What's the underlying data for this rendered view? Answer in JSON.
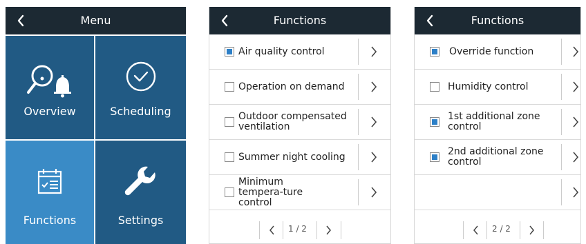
{
  "menu": {
    "title": "Menu",
    "tiles": [
      {
        "label": "Overview",
        "icon": "overview-search-bell-icon"
      },
      {
        "label": "Scheduling",
        "icon": "clock-icon"
      },
      {
        "label": "Functions",
        "icon": "calendar-list-icon"
      },
      {
        "label": "Settings",
        "icon": "wrench-icon"
      }
    ]
  },
  "functions_page1": {
    "title": "Functions",
    "items": [
      {
        "label": "Air quality control",
        "checked": true
      },
      {
        "label": "Operation on demand",
        "checked": false
      },
      {
        "label": "Outdoor compensated ventilation",
        "checked": false
      },
      {
        "label": "Summer night cooling",
        "checked": false
      },
      {
        "label": "Minimum tempera-ture control",
        "checked": false
      }
    ],
    "pager": "1 / 2"
  },
  "functions_page2": {
    "title": "Functions",
    "items": [
      {
        "label": "Override function",
        "checked": true
      },
      {
        "label": "Humidity control",
        "checked": false
      },
      {
        "label": "1st additional zone control",
        "checked": true
      },
      {
        "label": "2nd additional zone control",
        "checked": true
      },
      {
        "label": "",
        "checked": false
      }
    ],
    "pager": "2 / 2"
  },
  "colors": {
    "header": "#1c2933",
    "tile": "#215a84",
    "tile_active": "#3a8bc6",
    "checkbox_fill": "#2c7fc7"
  }
}
